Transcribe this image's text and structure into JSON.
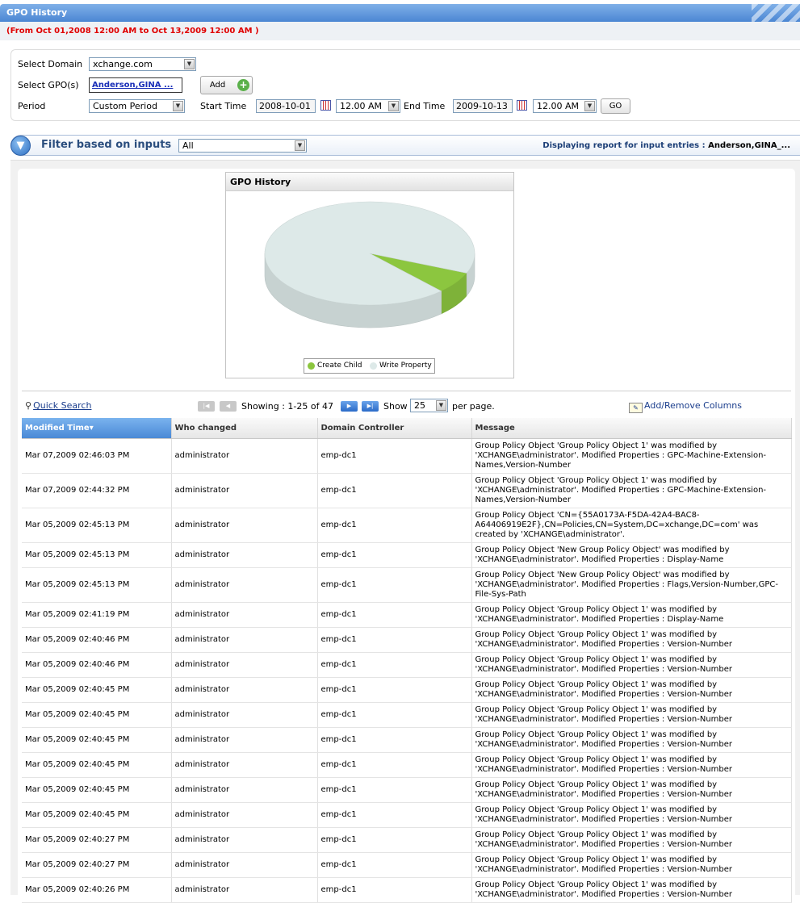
{
  "window": {
    "title": "GPO History"
  },
  "date_range": "(From Oct 01,2008 12:00 AM to Oct 13,2009 12:00 AM )",
  "inputs": {
    "domain_label": "Select Domain",
    "domain_value": "xchange.com",
    "gpo_label": "Select GPO(s)",
    "gpo_value": "Anderson,GINA ...",
    "add_label": "Add",
    "period_label": "Period",
    "period_value": "Custom Period",
    "start_label": "Start Time",
    "start_date": "2008-10-01",
    "start_time": "12.00 AM",
    "end_label": "End Time",
    "end_date": "2009-10-13",
    "end_time": "12.00 AM",
    "go_label": "GO"
  },
  "filter": {
    "title": "Filter based on inputs",
    "value": "All",
    "display_prefix": "Displaying report for input entries :",
    "display_entries": "Anderson,GINA_..."
  },
  "chart_data": {
    "type": "pie",
    "title": "GPO History",
    "categories": [
      "Create Child",
      "Write Property"
    ],
    "values": [
      1,
      46
    ],
    "colors": [
      "#8cc63f",
      "#dde9e8"
    ]
  },
  "toolbar": {
    "quick_search": "Quick Search",
    "showing": "Showing : 1-25 of 47",
    "show_label": "Show",
    "per_page_value": "25",
    "per_page_label": "per page.",
    "add_remove": "Add/Remove Columns"
  },
  "table": {
    "headers": [
      "Modified Time",
      "Who changed",
      "Domain Controller",
      "Message"
    ],
    "rows": [
      [
        "Mar 07,2009 02:46:03 PM",
        "administrator",
        "emp-dc1",
        "Group Policy Object 'Group Policy Object 1' was modified by 'XCHANGE\\administrator'. Modified Properties : GPC-Machine-Extension-Names,Version-Number"
      ],
      [
        "Mar 07,2009 02:44:32 PM",
        "administrator",
        "emp-dc1",
        "Group Policy Object 'Group Policy Object 1' was modified by 'XCHANGE\\administrator'. Modified Properties : GPC-Machine-Extension-Names,Version-Number"
      ],
      [
        "Mar 05,2009 02:45:13 PM",
        "administrator",
        "emp-dc1",
        "Group Policy Object 'CN={55A0173A-F5DA-42A4-BAC8-A64406919E2F},CN=Policies,CN=System,DC=xchange,DC=com' was created by 'XCHANGE\\administrator'."
      ],
      [
        "Mar 05,2009 02:45:13 PM",
        "administrator",
        "emp-dc1",
        "Group Policy Object 'New Group Policy Object' was modified by 'XCHANGE\\administrator'. Modified Properties : Display-Name"
      ],
      [
        "Mar 05,2009 02:45:13 PM",
        "administrator",
        "emp-dc1",
        "Group Policy Object 'New Group Policy Object' was modified by 'XCHANGE\\administrator'. Modified Properties : Flags,Version-Number,GPC-File-Sys-Path"
      ],
      [
        "Mar 05,2009 02:41:19 PM",
        "administrator",
        "emp-dc1",
        "Group Policy Object 'Group Policy Object 1' was modified by 'XCHANGE\\administrator'. Modified Properties : Display-Name"
      ],
      [
        "Mar 05,2009 02:40:46 PM",
        "administrator",
        "emp-dc1",
        "Group Policy Object 'Group Policy Object 1' was modified by 'XCHANGE\\administrator'. Modified Properties : Version-Number"
      ],
      [
        "Mar 05,2009 02:40:46 PM",
        "administrator",
        "emp-dc1",
        "Group Policy Object 'Group Policy Object 1' was modified by 'XCHANGE\\administrator'. Modified Properties : Version-Number"
      ],
      [
        "Mar 05,2009 02:40:45 PM",
        "administrator",
        "emp-dc1",
        "Group Policy Object 'Group Policy Object 1' was modified by 'XCHANGE\\administrator'. Modified Properties : Version-Number"
      ],
      [
        "Mar 05,2009 02:40:45 PM",
        "administrator",
        "emp-dc1",
        "Group Policy Object 'Group Policy Object 1' was modified by 'XCHANGE\\administrator'. Modified Properties : Version-Number"
      ],
      [
        "Mar 05,2009 02:40:45 PM",
        "administrator",
        "emp-dc1",
        "Group Policy Object 'Group Policy Object 1' was modified by 'XCHANGE\\administrator'. Modified Properties : Version-Number"
      ],
      [
        "Mar 05,2009 02:40:45 PM",
        "administrator",
        "emp-dc1",
        "Group Policy Object 'Group Policy Object 1' was modified by 'XCHANGE\\administrator'. Modified Properties : Version-Number"
      ],
      [
        "Mar 05,2009 02:40:45 PM",
        "administrator",
        "emp-dc1",
        "Group Policy Object 'Group Policy Object 1' was modified by 'XCHANGE\\administrator'. Modified Properties : Version-Number"
      ],
      [
        "Mar 05,2009 02:40:45 PM",
        "administrator",
        "emp-dc1",
        "Group Policy Object 'Group Policy Object 1' was modified by 'XCHANGE\\administrator'. Modified Properties : Version-Number"
      ],
      [
        "Mar 05,2009 02:40:27 PM",
        "administrator",
        "emp-dc1",
        "Group Policy Object 'Group Policy Object 1' was modified by 'XCHANGE\\administrator'. Modified Properties : Version-Number"
      ],
      [
        "Mar 05,2009 02:40:27 PM",
        "administrator",
        "emp-dc1",
        "Group Policy Object 'Group Policy Object 1' was modified by 'XCHANGE\\administrator'. Modified Properties : Version-Number"
      ],
      [
        "Mar 05,2009 02:40:26 PM",
        "administrator",
        "emp-dc1",
        "Group Policy Object 'Group Policy Object 1' was modified by 'XCHANGE\\administrator'. Modified Properties : Version-Number"
      ]
    ]
  }
}
